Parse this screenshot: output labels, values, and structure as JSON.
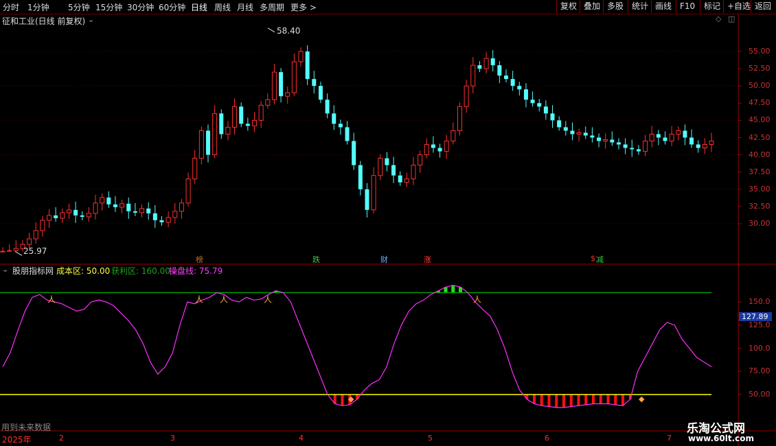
{
  "toolbar": {
    "periods": [
      "分时",
      "1分钟",
      "5分钟",
      "15分钟",
      "30分钟",
      "60分钟",
      "日线",
      "周线",
      "月线",
      "多周期",
      "更多 >"
    ],
    "active": "日线",
    "right_buttons": [
      "复权",
      "叠加",
      "多股",
      "统计",
      "画线",
      "F10",
      "标记",
      "+自选",
      "返回"
    ]
  },
  "main": {
    "title": "征和工业(日线 前复权)",
    "high_label": "58.40",
    "low_label": "25.97",
    "price_ticks": [
      "55.00",
      "52.50",
      "50.00",
      "47.50",
      "45.00",
      "42.50",
      "40.00",
      "37.50",
      "35.00",
      "32.50",
      "30.00"
    ],
    "annotations": [
      {
        "text": "榜",
        "color": "#c07030"
      },
      {
        "text": "跌",
        "color": "#40c040"
      },
      {
        "text": "财",
        "color": "#6ab0ff"
      },
      {
        "text": "涨",
        "color": "#ff4040"
      },
      {
        "text": "$",
        "color": "#ff3030"
      },
      {
        "text": "减",
        "color": "#40c040"
      }
    ]
  },
  "indicator": {
    "name": "股朋指标网",
    "cost_label": "成本区: 50.00",
    "profit_label": "获利区: 160.00",
    "trade_label": "操盘线: 75.79",
    "ticks": [
      "150.0",
      "125.0",
      "100.0",
      "75.00",
      "50.00"
    ],
    "current_value": "127.89",
    "footer_note": "用到未来数据"
  },
  "axis": {
    "year": "2025年",
    "months": [
      "2",
      "3",
      "4",
      "5",
      "6",
      "7"
    ]
  },
  "watermark": {
    "line1": "乐淘公式网",
    "line2": "www.60lt.com"
  },
  "colors": {
    "up": "#ff3030",
    "down": "#54ffff",
    "cost_line": "#ffff00",
    "profit_line": "#00a000",
    "trade_line": "#ff30ff"
  }
}
